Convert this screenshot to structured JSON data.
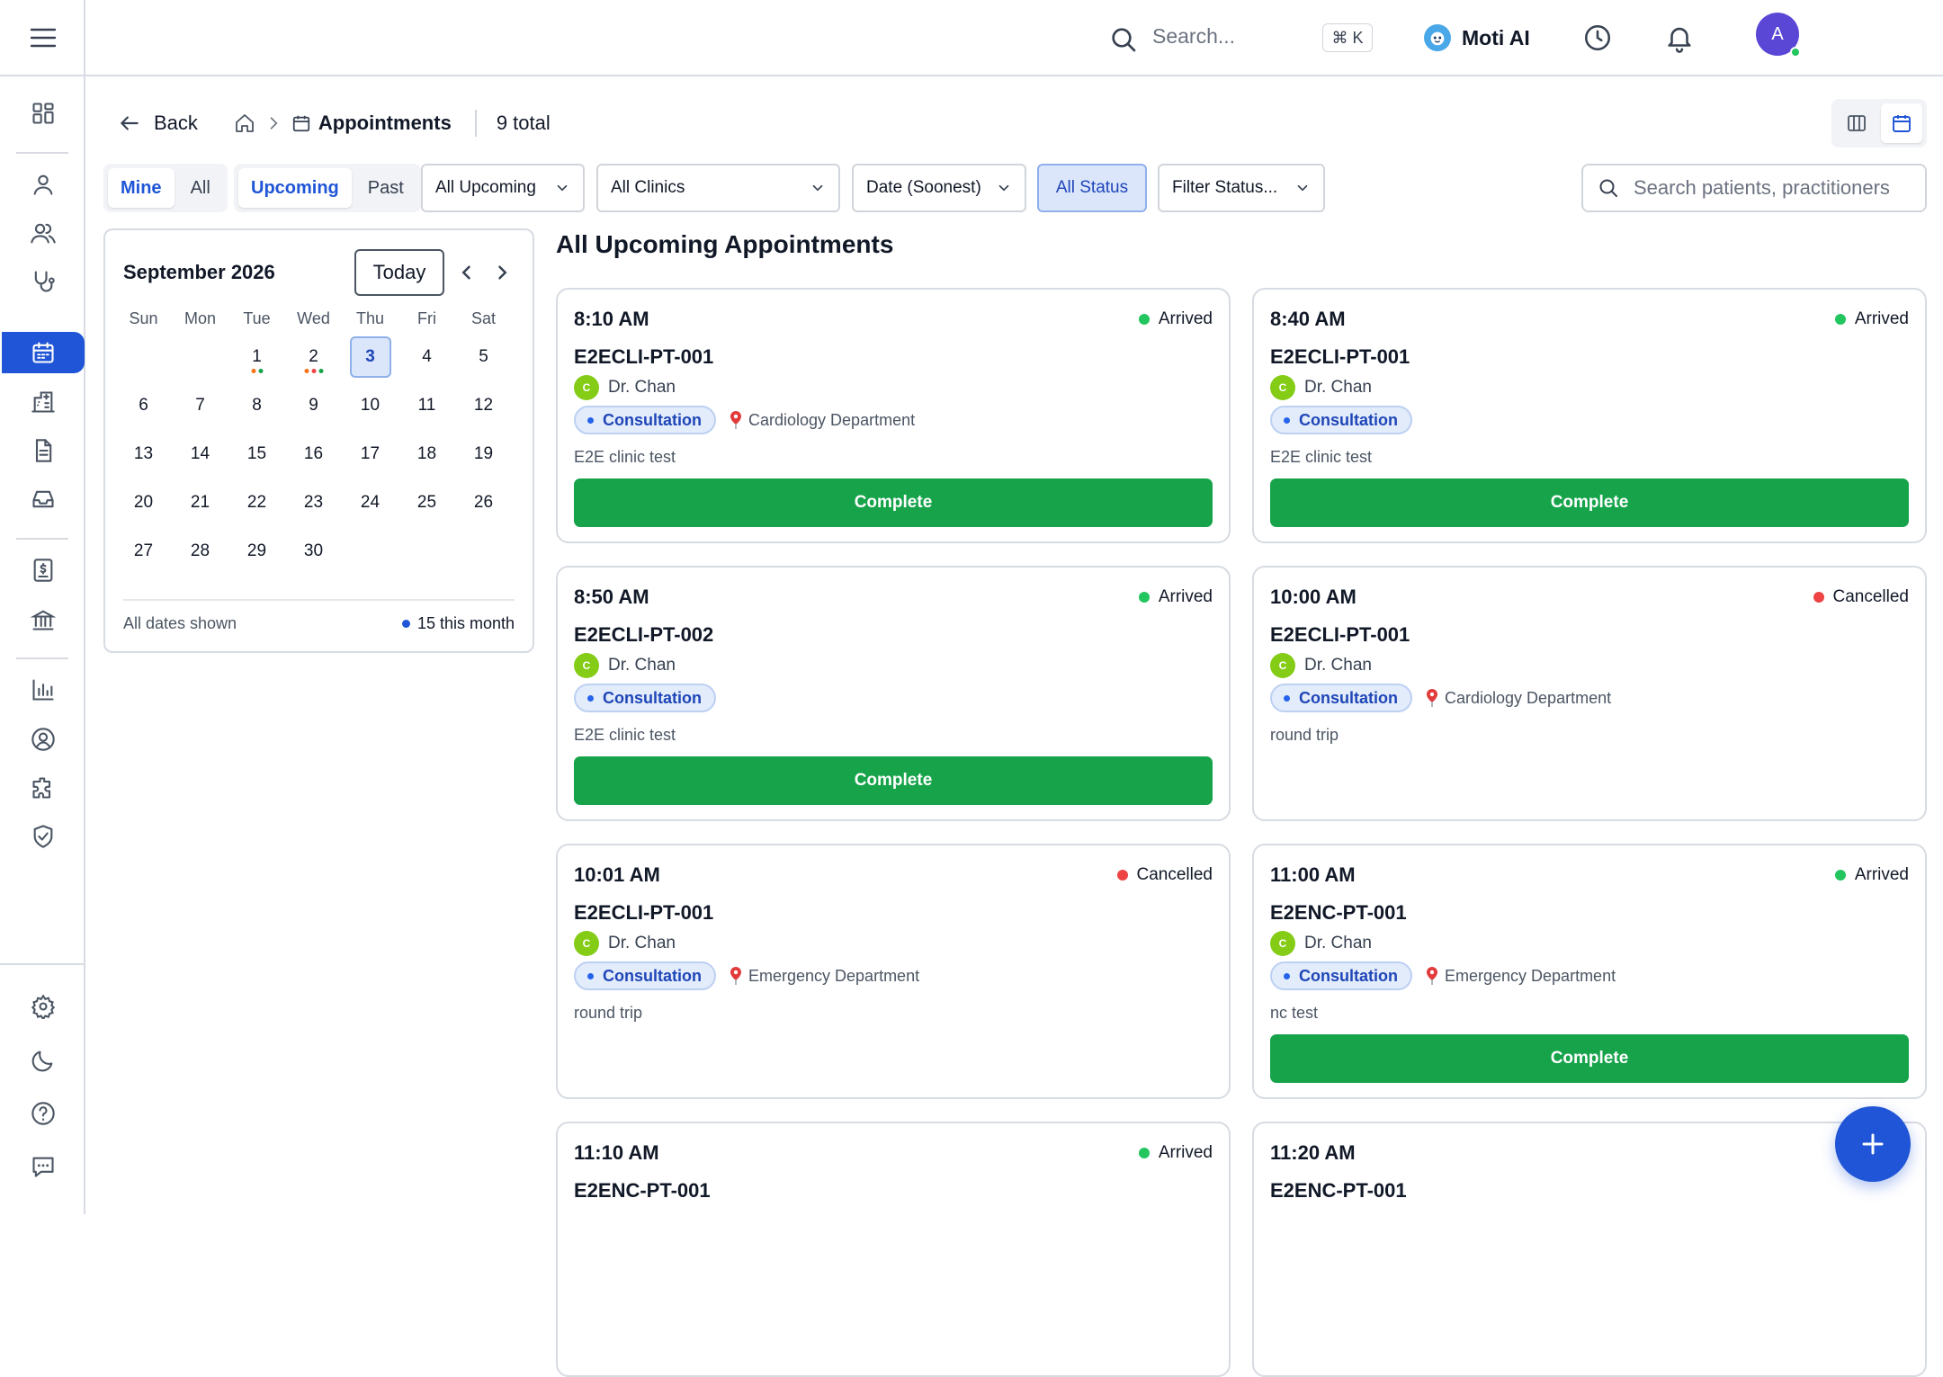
{
  "topbar": {
    "search_placeholder": "Search...",
    "shortcut_symbol": "⌘",
    "shortcut_key": "K",
    "ai_label": "Moti AI",
    "avatar_initial": "A"
  },
  "breadcrumb": {
    "back_label": "Back",
    "current": "Appointments",
    "total": "9 total"
  },
  "filters": {
    "owner": [
      "Mine",
      "All"
    ],
    "owner_selected": "Mine",
    "timeframe": [
      "Upcoming",
      "Past"
    ],
    "timeframe_selected": "Upcoming",
    "range": "All Upcoming",
    "clinic": "All Clinics",
    "sort": "Date (Soonest)",
    "status": "All Status",
    "status_filter": "Filter Status...",
    "search_placeholder": "Search patients, practitioners"
  },
  "calendar": {
    "month": "September 2026",
    "today_label": "Today",
    "weekdays": [
      "Sun",
      "Mon",
      "Tue",
      "Wed",
      "Thu",
      "Fri",
      "Sat"
    ],
    "lead_blanks": 2,
    "days": 30,
    "selected_day": 3,
    "day_dots": {
      "1": [
        "#f97316",
        "#16a34a"
      ],
      "2": [
        "#f97316",
        "#ef4444",
        "#16a34a"
      ]
    },
    "footer_left": "All dates shown",
    "footer_right": "15 this month"
  },
  "list_title": "All Upcoming Appointments",
  "colors": {
    "accent": "#1f55d6",
    "arrived": "#22c55e",
    "cancelled": "#ef4444",
    "complete": "#16a34a"
  },
  "appointments": [
    {
      "time": "8:10 AM",
      "status": "Arrived",
      "patient": "E2ECLI-PT-001",
      "practitioner": "Dr. Chan",
      "practitioner_initial": "C",
      "type": "Consultation",
      "location": "Cardiology Department",
      "note": "E2E clinic test",
      "action": "Complete"
    },
    {
      "time": "8:40 AM",
      "status": "Arrived",
      "patient": "E2ECLI-PT-001",
      "practitioner": "Dr. Chan",
      "practitioner_initial": "C",
      "type": "Consultation",
      "location": "",
      "note": "E2E clinic test",
      "action": "Complete"
    },
    {
      "time": "8:50 AM",
      "status": "Arrived",
      "patient": "E2ECLI-PT-002",
      "practitioner": "Dr. Chan",
      "practitioner_initial": "C",
      "type": "Consultation",
      "location": "",
      "note": "E2E clinic test",
      "action": "Complete"
    },
    {
      "time": "10:00 AM",
      "status": "Cancelled",
      "patient": "E2ECLI-PT-001",
      "practitioner": "Dr. Chan",
      "practitioner_initial": "C",
      "type": "Consultation",
      "location": "Cardiology Department",
      "note": "round trip",
      "action": ""
    },
    {
      "time": "10:01 AM",
      "status": "Cancelled",
      "patient": "E2ECLI-PT-001",
      "practitioner": "Dr. Chan",
      "practitioner_initial": "C",
      "type": "Consultation",
      "location": "Emergency Department",
      "note": "round trip",
      "action": ""
    },
    {
      "time": "11:00 AM",
      "status": "Arrived",
      "patient": "E2ENC-PT-001",
      "practitioner": "Dr. Chan",
      "practitioner_initial": "C",
      "type": "Consultation",
      "location": "Emergency Department",
      "note": "nc test",
      "action": "Complete"
    },
    {
      "time": "11:10 AM",
      "status": "Arrived",
      "patient": "E2ENC-PT-001",
      "practitioner": "",
      "practitioner_initial": "",
      "type": "",
      "location": "",
      "note": "",
      "action": ""
    },
    {
      "time": "11:20 AM",
      "status": "",
      "patient": "E2ENC-PT-001",
      "practitioner": "",
      "practitioner_initial": "",
      "type": "",
      "location": "",
      "note": "",
      "action": ""
    }
  ],
  "sidebar_icons": [
    "menu-icon",
    "dashboard-icon",
    "patient-icon",
    "users-icon",
    "stethoscope-icon",
    "calendar-icon",
    "clinic-building-icon",
    "document-icon",
    "inbox-icon",
    "billing-icon",
    "bank-icon",
    "analytics-icon",
    "profile-icon",
    "integrations-icon",
    "security-icon",
    "settings-icon",
    "dark-mode-icon",
    "help-icon",
    "feedback-icon"
  ]
}
